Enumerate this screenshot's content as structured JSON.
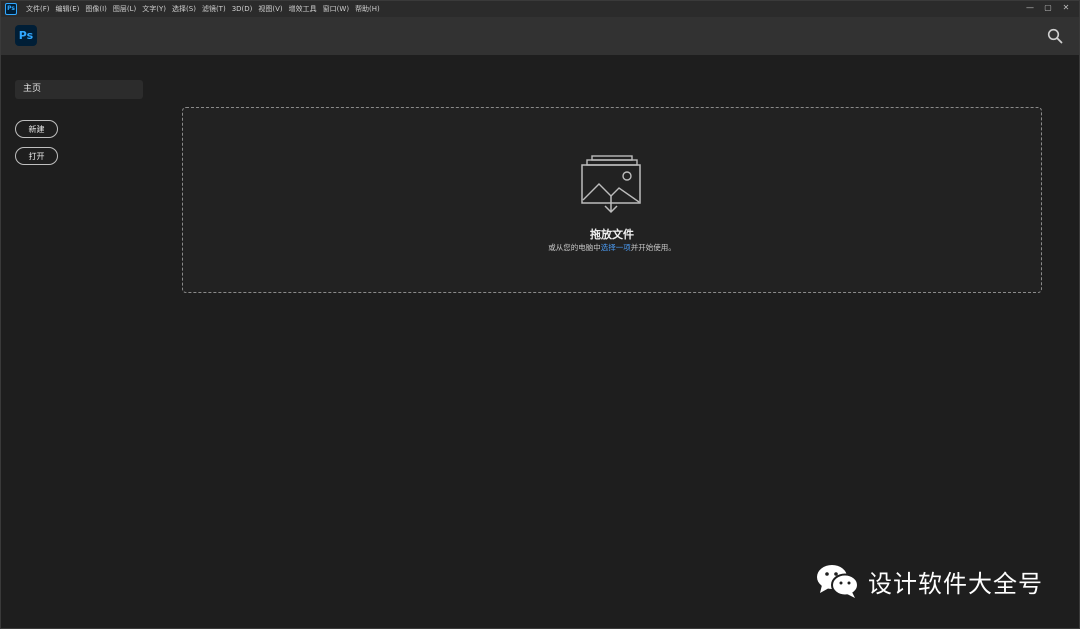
{
  "app": {
    "mini_icon_label": "Ps",
    "logo_label": "Ps"
  },
  "menubar": {
    "items": [
      "文件(F)",
      "编辑(E)",
      "图像(I)",
      "图层(L)",
      "文字(Y)",
      "选择(S)",
      "滤镜(T)",
      "3D(D)",
      "视图(V)",
      "增效工具",
      "窗口(W)",
      "帮助(H)"
    ]
  },
  "window_controls": {
    "minimize": "—",
    "maximize": "▢",
    "close": "✕"
  },
  "sidebar": {
    "home_label": "主页",
    "new_label": "新建",
    "open_label": "打开"
  },
  "dropzone": {
    "title": "拖放文件",
    "sub_prefix": "或从您的电脑中",
    "sub_link": "选择一项",
    "sub_suffix": "并开始使用。"
  },
  "watermark": {
    "text": "设计软件大全号"
  },
  "colors": {
    "accent": "#31a8ff",
    "link": "#4b9cf5",
    "background": "#1e1e1e"
  },
  "icons": {
    "search": "search-icon",
    "drop": "image-stack-icon",
    "watermark": "wechat-icon"
  }
}
